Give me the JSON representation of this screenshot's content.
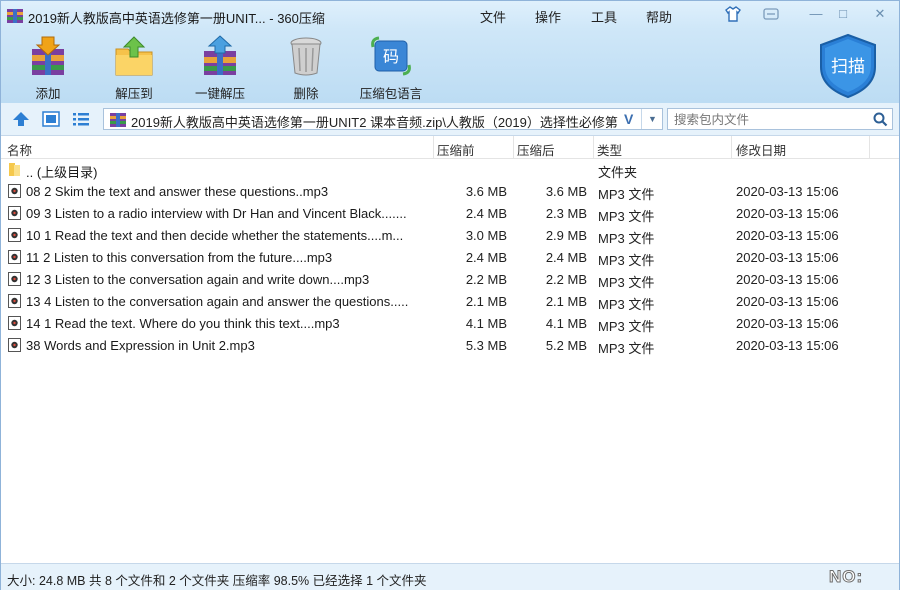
{
  "window": {
    "title": "2019新人教版高中英语选修第一册UNIT... - 360压缩",
    "menu": [
      "文件",
      "操作",
      "工具",
      "帮助"
    ],
    "controls": {
      "skin": "",
      "feedback": "",
      "minimize": "—",
      "maximize": "□",
      "close": "✕"
    }
  },
  "toolbar": {
    "add": "添加",
    "extract_to": "解压到",
    "one_click_extract": "一键解压",
    "delete": "删除",
    "archive_language": "压缩包语言",
    "lang_icon_char": "码",
    "scan": "扫描"
  },
  "address": {
    "path": "2019新人教版高中英语选修第一册UNIT2 课本音频.zip\\人教版（2019）选择性必修第",
    "v_mark": "V",
    "search_placeholder": "搜索包内文件"
  },
  "columns": {
    "name": "名称",
    "before": "压缩前",
    "after": "压缩后",
    "type": "类型",
    "date": "修改日期"
  },
  "files": [
    {
      "name": ".. (上级目录)",
      "before": "",
      "after": "",
      "type": "文件夹",
      "date": "",
      "kind": "folder"
    },
    {
      "name": "08 2 Skim the text and answer these questions..mp3",
      "before": "3.6 MB",
      "after": "3.6 MB",
      "type": "MP3 文件",
      "date": "2020-03-13 15:06",
      "kind": "mp3"
    },
    {
      "name": "09 3 Listen to a radio interview with Dr Han and Vincent Black.......",
      "before": "2.4 MB",
      "after": "2.3 MB",
      "type": "MP3 文件",
      "date": "2020-03-13 15:06",
      "kind": "mp3"
    },
    {
      "name": "10 1 Read the text and then decide whether the statements....m...",
      "before": "3.0 MB",
      "after": "2.9 MB",
      "type": "MP3 文件",
      "date": "2020-03-13 15:06",
      "kind": "mp3"
    },
    {
      "name": "11 2 Listen to this conversation from the future....mp3",
      "before": "2.4 MB",
      "after": "2.4 MB",
      "type": "MP3 文件",
      "date": "2020-03-13 15:06",
      "kind": "mp3"
    },
    {
      "name": "12 3 Listen to the conversation again and write down....mp3",
      "before": "2.2 MB",
      "after": "2.2 MB",
      "type": "MP3 文件",
      "date": "2020-03-13 15:06",
      "kind": "mp3"
    },
    {
      "name": "13 4 Listen to the conversation again and answer the questions.....",
      "before": "2.1 MB",
      "after": "2.1 MB",
      "type": "MP3 文件",
      "date": "2020-03-13 15:06",
      "kind": "mp3"
    },
    {
      "name": "14 1 Read the text. Where do you think this text....mp3",
      "before": "4.1 MB",
      "after": "4.1 MB",
      "type": "MP3 文件",
      "date": "2020-03-13 15:06",
      "kind": "mp3"
    },
    {
      "name": "38 Words and Expression in Unit 2.mp3",
      "before": "5.3 MB",
      "after": "5.2 MB",
      "type": "MP3 文件",
      "date": "2020-03-13 15:06",
      "kind": "mp3"
    }
  ],
  "status": {
    "summary": "大小: 24.8 MB 共 8 个文件和 2 个文件夹 压缩率 98.5% 已经选择 1 个文件夹",
    "no_label": "NO:"
  },
  "colors": {
    "accent": "#2d7fd3",
    "titlebar": "#d8ecfa",
    "toolbar": "#c6e2f6"
  }
}
